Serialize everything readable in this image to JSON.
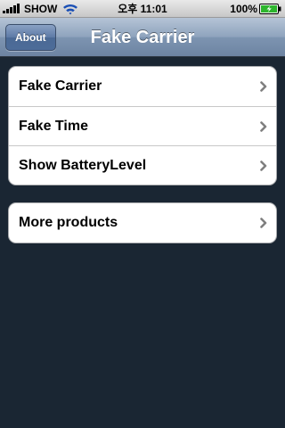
{
  "status_bar": {
    "carrier": "SHOW",
    "clock": "오후 11:01",
    "battery_percent": "100%",
    "icons": [
      "signal-bars-icon",
      "wifi-icon",
      "battery-charging-icon"
    ]
  },
  "nav_bar": {
    "left_button": "About",
    "title": "Fake Carrier"
  },
  "groups": [
    {
      "rows": [
        {
          "label": "Fake Carrier",
          "accessory": "chevron-right-icon"
        },
        {
          "label": "Fake Time",
          "accessory": "chevron-right-icon"
        },
        {
          "label": "Show BatteryLevel",
          "accessory": "chevron-right-icon"
        }
      ]
    },
    {
      "rows": [
        {
          "label": "More products",
          "accessory": "chevron-right-icon"
        }
      ]
    }
  ],
  "colors": {
    "background": "#1a2633",
    "nav_bar": "#8ea3bd",
    "nav_button": "#4d6c99",
    "cell": "#ffffff",
    "separator": "#c8c8c8",
    "chevron": "#7f7f7f"
  }
}
